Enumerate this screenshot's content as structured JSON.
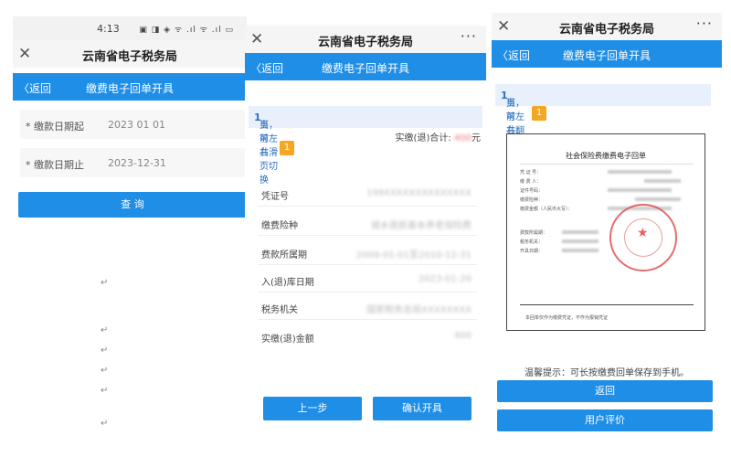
{
  "panel1": {
    "status_time": "4:13",
    "status_icons": "▣ ◨ ◈ ᯤ .ıl ᯤ .ıl ▭",
    "window_title": "云南省电子税务局",
    "back_label": "返回",
    "nav_title": "缴费电子回单开具",
    "fields": [
      {
        "label": "* 缴款日期起",
        "value": "2023 01 01"
      },
      {
        "label": "* 缴款日期止",
        "value": "2023-12-31"
      }
    ],
    "query_label": "查 询",
    "return_marks": [
      "↵",
      "↵",
      "↵",
      "↵",
      "↵",
      "↵"
    ]
  },
  "panel2": {
    "window_title": "云南省电子税务局",
    "more": "···",
    "back_label": "返回",
    "nav_title": "缴费电子回单开具",
    "page_prefix": "当前共",
    "page_num": "1",
    "page_suffix": "页，可左右滑页切换",
    "total_label": "实缴(退)合计:",
    "total_value": "400",
    "total_unit": "元",
    "badge": "1",
    "rows": [
      {
        "key": "凭证号",
        "value": "199XXXXXXXXXXXXXX"
      },
      {
        "key": "缴费险种",
        "value": "城乡居民基本养老保险费"
      },
      {
        "key": "费款所属期",
        "value": "2009-01-01至2010-12-31"
      },
      {
        "key": "入(退)库日期",
        "value": "2023-01-20"
      },
      {
        "key": "税务机关",
        "value": "国家税务总局XXXXXXXX"
      },
      {
        "key": "实缴(退)金额",
        "value": "400"
      }
    ],
    "prev_label": "上一步",
    "confirm_label": "确认开具"
  },
  "panel3": {
    "window_title": "云南省电子税务局",
    "more": "···",
    "back_label": "返回",
    "nav_title": "缴费电子回单开具",
    "page_prefix": "当前共",
    "page_num": "1",
    "page_suffix": "页，可左右翻页切换",
    "badge": "1",
    "receipt_title": "社会保险费缴费电子回单",
    "receipt_labels": [
      "凭 证 号：",
      "缴 费 人：",
      "证件号码：",
      "缴费险种：",
      "缴费金额（人民币大写）：",
      "费款所属期：",
      "税务机关：",
      "开具日期："
    ],
    "receipt_footer": "本回单仅作为缴费凭证，不作为报销凭证",
    "tip": "温馨提示：可长按缴费回单保存到手机。",
    "return_label": "返回",
    "rate_label": "用户评价"
  }
}
